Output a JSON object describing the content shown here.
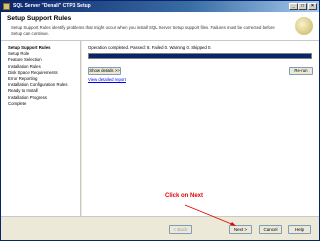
{
  "window": {
    "title": "SQL Server \"Denali\" CTP3 Setup"
  },
  "header": {
    "title": "Setup Support Rules",
    "description": "Setup Support Rules identify problems that might occur when you install SQL Server Setup support files. Failures must be corrected before Setup can continue."
  },
  "sidebar": {
    "items": [
      {
        "label": "Setup Support Rules",
        "active": true
      },
      {
        "label": "Setup Role",
        "active": false
      },
      {
        "label": "Feature Selection",
        "active": false
      },
      {
        "label": "Installation Rules",
        "active": false
      },
      {
        "label": "Disk Space Requirements",
        "active": false
      },
      {
        "label": "Error Reporting",
        "active": false
      },
      {
        "label": "Installation Configuration Rules",
        "active": false
      },
      {
        "label": "Ready to Install",
        "active": false
      },
      {
        "label": "Installation Progress",
        "active": false
      },
      {
        "label": "Complete",
        "active": false
      }
    ]
  },
  "main": {
    "status": "Operation completed. Passed: 8.   Failed 0.   Warning 0.   Skipped 0.",
    "progress_fraction": 1.0,
    "show_details_label": "Show details >>",
    "rerun_label": "Re-run",
    "view_report_link": "View detailed report"
  },
  "footer": {
    "back_label": "< Back",
    "next_label": "Next >",
    "cancel_label": "Cancel",
    "help_label": "Help"
  },
  "annotation": {
    "text": "Click on Next",
    "color": "#e00000"
  },
  "colors": {
    "titlebar": "#0a246a",
    "progress_fill": "#0a246a",
    "link": "#0000ee"
  }
}
